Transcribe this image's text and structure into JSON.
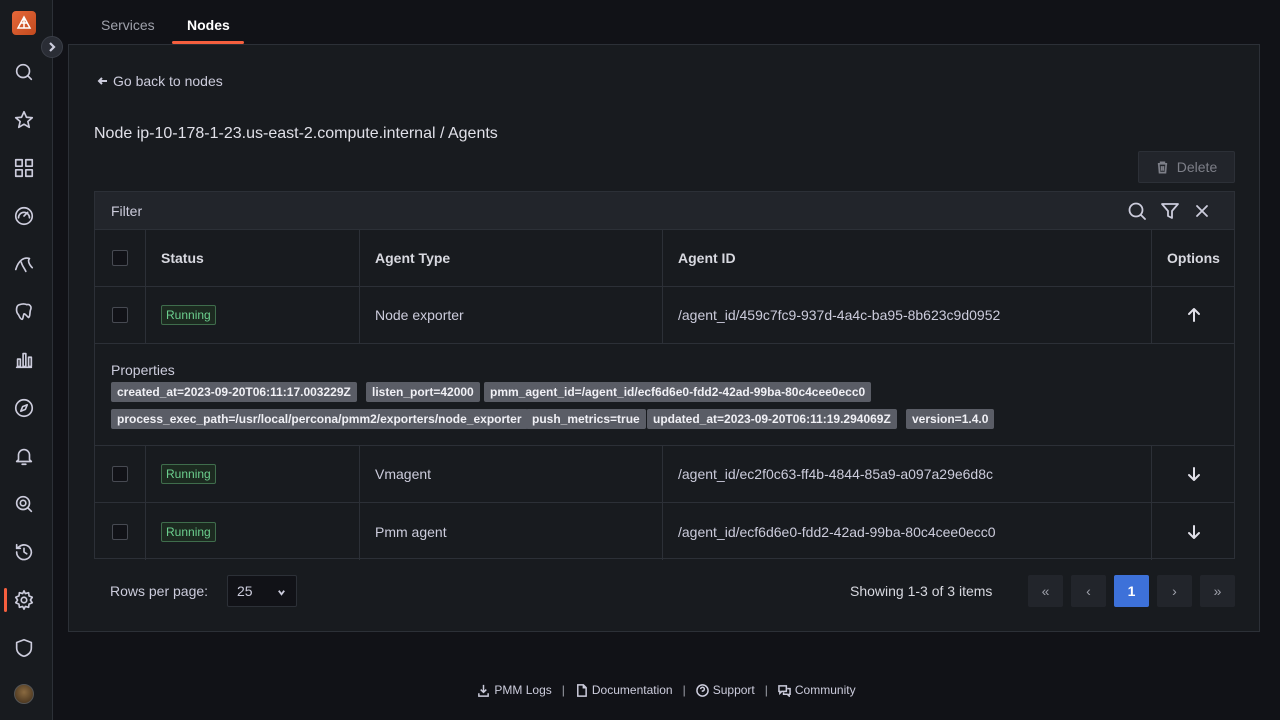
{
  "tabs": [
    {
      "label": "Services",
      "active": false
    },
    {
      "label": "Nodes",
      "active": true
    }
  ],
  "back_link": "Go back to nodes",
  "page_title": "Node ip-10-178-1-23.us-east-2.compute.internal / Agents",
  "delete_label": "Delete",
  "filter_label": "Filter",
  "columns": [
    "Status",
    "Agent Type",
    "Agent ID",
    "Options"
  ],
  "rows": [
    {
      "status": "Running",
      "type": "Node exporter",
      "id": "/agent_id/459c7fc9-937d-4a4c-ba95-8b623c9d0952",
      "expanded": true
    },
    {
      "status": "Running",
      "type": "Vmagent",
      "id": "/agent_id/ec2f0c63-ff4b-4844-85a9-a097a29e6d8c",
      "expanded": false
    },
    {
      "status": "Running",
      "type": "Pmm agent",
      "id": "/agent_id/ecf6d6e0-fdd2-42ad-99ba-80c4cee0ecc0",
      "expanded": false
    }
  ],
  "properties": {
    "title": "Properties",
    "chips": [
      "created_at=2023-09-20T06:11:17.003229Z",
      "listen_port=42000",
      "pmm_agent_id=/agent_id/ecf6d6e0-fdd2-42ad-99ba-80c4cee0ecc0",
      "process_exec_path=/usr/local/percona/pmm2/exporters/node_exporter",
      "push_metrics=true",
      "updated_at=2023-09-20T06:11:19.294069Z",
      "version=1.4.0"
    ]
  },
  "pagination": {
    "rows_label": "Rows per page:",
    "rows_value": "25",
    "showing": "Showing 1-3 of 3 items",
    "first": "«",
    "prev": "‹",
    "current": "1",
    "next": "›",
    "last": "»"
  },
  "footer": {
    "logs": "PMM Logs",
    "docs": "Documentation",
    "support": "Support",
    "community": "Community",
    "separator": "|"
  },
  "colors": {
    "accent": "#f55f3e",
    "page_active": "#3d71d9",
    "running": "#6ccf8e"
  }
}
